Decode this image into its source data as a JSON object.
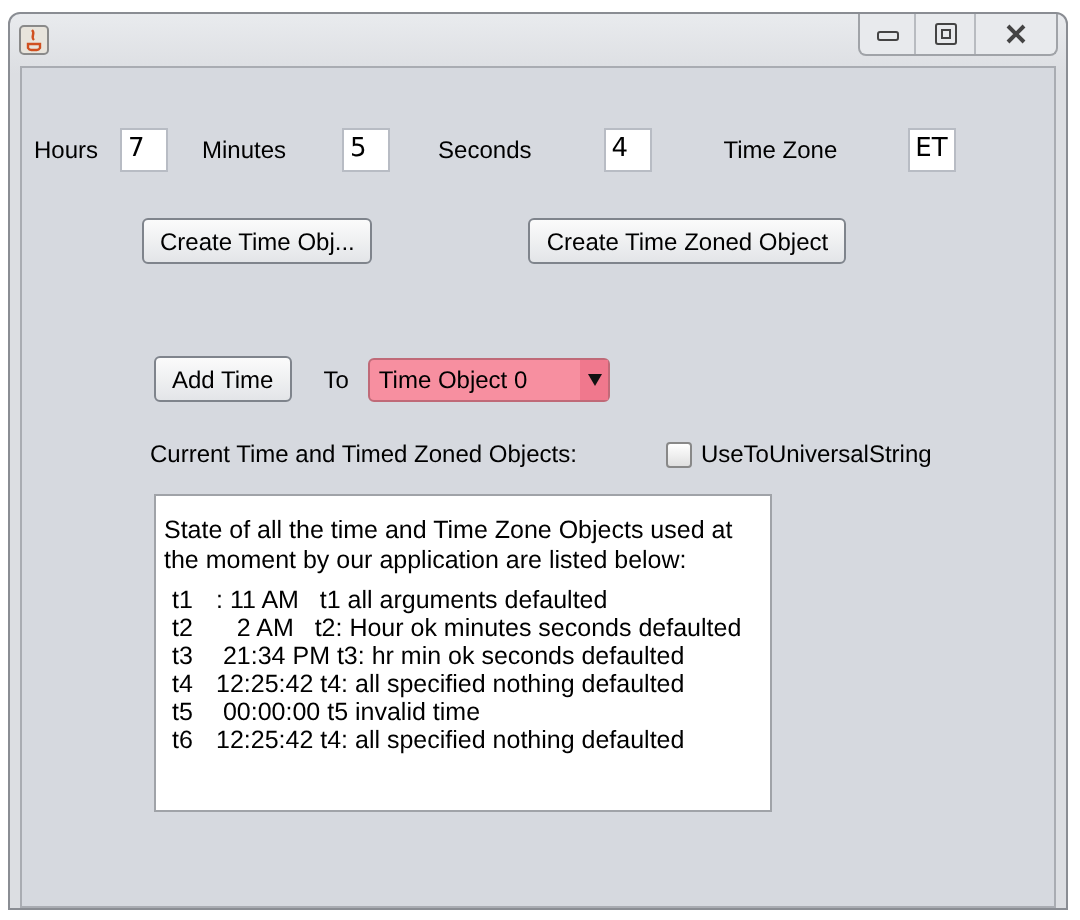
{
  "fields": [
    {
      "label": "Hours",
      "value": "7"
    },
    {
      "label": "Minutes",
      "value": "5"
    },
    {
      "label": "Seconds",
      "value": "4"
    },
    {
      "label": "Time Zone",
      "value": "ET"
    }
  ],
  "create_buttons": [
    "Create Time Obj...",
    "Create Time Zoned Object"
  ],
  "add_button": "Add Time",
  "to_label": "To",
  "target_combo": {
    "value": "Time Object 0"
  },
  "objects_label": "Current Time and Timed Zoned Objects:",
  "universal_checkbox": {
    "label": "UseToUniversalString",
    "checked": false
  },
  "output": {
    "intro": "State of all the time and Time Zone Objects used at the moment by our application  are listed below:",
    "lines": [
      {
        "tag": "t1",
        "text": ": 11 AM   t1 all arguments defaulted"
      },
      {
        "tag": "t2",
        "text": "   2 AM   t2: Hour ok minutes seconds defaulted"
      },
      {
        "tag": "t3",
        "text": " 21:34 PM t3: hr min ok seconds defaulted"
      },
      {
        "tag": "t4",
        "text": "12:25:42 t4: all specified nothing defaulted"
      },
      {
        "tag": "t5",
        "text": " 00:00:00 t5 invalid time"
      },
      {
        "tag": "t6",
        "text": "12:25:42 t4: all specified nothing defaulted"
      }
    ]
  }
}
